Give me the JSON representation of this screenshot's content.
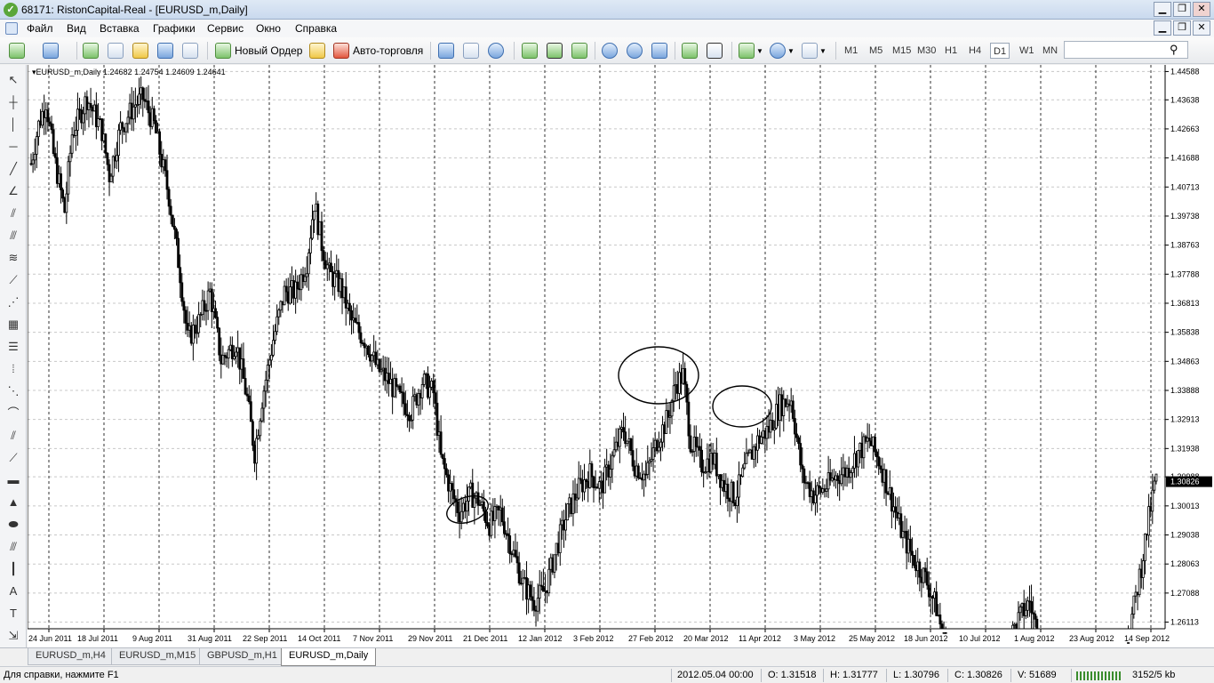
{
  "window": {
    "title": "68171: RistonCapital-Real - [EURUSD_m,Daily]",
    "icon": "terminal-logo-icon",
    "minimize": "▁",
    "restore": "❐",
    "close": "✕"
  },
  "menu": {
    "items": [
      "Файл",
      "Вид",
      "Вставка",
      "Графики",
      "Сервис",
      "Окно",
      "Справка"
    ]
  },
  "toolbar": {
    "new_order": "Новый Ордер",
    "auto_trading": "Авто-торговля",
    "timeframes": [
      "M1",
      "M5",
      "M15",
      "M30",
      "H1",
      "H4",
      "D1",
      "W1",
      "MN"
    ],
    "active_timeframe": "D1",
    "search_value": "",
    "search_icon": "magnifier-icon"
  },
  "chart": {
    "label": "EURUSD_m,Daily  1.24682 1.24754 1.24609 1.24641",
    "grid": "dashed",
    "background": "#ffffff",
    "candle_color": "#000000"
  },
  "chart_data": {
    "type": "candlestick",
    "symbol": "EURUSD_m",
    "timeframe": "Daily",
    "ohlc_last": {
      "open": 1.24682,
      "high": 1.24754,
      "low": 1.24609,
      "close": 1.24641
    },
    "price_ticks": [
      1.44588,
      1.43638,
      1.42663,
      1.41688,
      1.40713,
      1.39738,
      1.38763,
      1.37788,
      1.36813,
      1.35838,
      1.34863,
      1.33888,
      1.32913,
      1.31938,
      1.30988,
      1.30013,
      1.29038,
      1.28063,
      1.27088,
      1.26113
    ],
    "current_price": 1.30826,
    "ylim": [
      1.2595,
      1.4475
    ],
    "date_ticks": [
      "24 Jun 2011",
      "18 Jul 2011",
      "9 Aug 2011",
      "31 Aug 2011",
      "22 Sep 2011",
      "14 Oct 2011",
      "7 Nov 2011",
      "29 Nov 2011",
      "21 Dec 2011",
      "12 Jan 2012",
      "3 Feb 2012",
      "27 Feb 2012",
      "20 Mar 2012",
      "11 Apr 2012",
      "3 May 2012",
      "25 May 2012",
      "18 Jun 2012",
      "10 Jul 2012",
      "1 Aug 2012",
      "23 Aug 2012",
      "14 Sep 2012"
    ],
    "path_closes": [
      [
        0,
        1.415
      ],
      [
        4,
        1.428
      ],
      [
        8,
        1.436
      ],
      [
        12,
        1.418
      ],
      [
        18,
        1.399
      ],
      [
        22,
        1.425
      ],
      [
        30,
        1.437
      ],
      [
        38,
        1.426
      ],
      [
        42,
        1.411
      ],
      [
        48,
        1.427
      ],
      [
        56,
        1.435
      ],
      [
        60,
        1.437
      ],
      [
        66,
        1.428
      ],
      [
        74,
        1.404
      ],
      [
        80,
        1.378
      ],
      [
        84,
        1.356
      ],
      [
        90,
        1.362
      ],
      [
        96,
        1.372
      ],
      [
        102,
        1.349
      ],
      [
        110,
        1.355
      ],
      [
        116,
        1.336
      ],
      [
        120,
        1.318
      ],
      [
        124,
        1.336
      ],
      [
        130,
        1.356
      ],
      [
        136,
        1.372
      ],
      [
        142,
        1.372
      ],
      [
        148,
        1.382
      ],
      [
        152,
        1.402
      ],
      [
        156,
        1.388
      ],
      [
        160,
        1.378
      ],
      [
        166,
        1.374
      ],
      [
        172,
        1.362
      ],
      [
        180,
        1.355
      ],
      [
        186,
        1.346
      ],
      [
        192,
        1.342
      ],
      [
        198,
        1.336
      ],
      [
        204,
        1.332
      ],
      [
        210,
        1.342
      ],
      [
        216,
        1.338
      ],
      [
        220,
        1.316
      ],
      [
        226,
        1.304
      ],
      [
        230,
        1.298
      ],
      [
        236,
        1.304
      ],
      [
        240,
        1.302
      ],
      [
        246,
        1.294
      ],
      [
        252,
        1.298
      ],
      [
        258,
        1.286
      ],
      [
        264,
        1.274
      ],
      [
        270,
        1.268
      ],
      [
        276,
        1.272
      ],
      [
        282,
        1.286
      ],
      [
        288,
        1.298
      ],
      [
        294,
        1.306
      ],
      [
        300,
        1.311
      ],
      [
        306,
        1.306
      ],
      [
        312,
        1.316
      ],
      [
        318,
        1.326
      ],
      [
        324,
        1.314
      ],
      [
        330,
        1.31
      ],
      [
        336,
        1.322
      ],
      [
        342,
        1.33
      ],
      [
        346,
        1.341
      ],
      [
        350,
        1.344
      ],
      [
        354,
        1.322
      ],
      [
        360,
        1.314
      ],
      [
        366,
        1.316
      ],
      [
        372,
        1.307
      ],
      [
        378,
        1.303
      ],
      [
        384,
        1.314
      ],
      [
        390,
        1.322
      ],
      [
        396,
        1.326
      ],
      [
        402,
        1.334
      ],
      [
        408,
        1.336
      ],
      [
        414,
        1.31
      ],
      [
        420,
        1.304
      ],
      [
        426,
        1.306
      ],
      [
        432,
        1.31
      ],
      [
        438,
        1.312
      ],
      [
        444,
        1.318
      ],
      [
        450,
        1.322
      ],
      [
        456,
        1.314
      ],
      [
        462,
        1.302
      ],
      [
        468,
        1.29
      ],
      [
        474,
        1.282
      ],
      [
        480,
        1.276
      ],
      [
        486,
        1.266
      ],
      [
        490,
        1.255
      ],
      [
        500,
        1.24
      ],
      [
        510,
        1.236
      ],
      [
        520,
        1.248
      ],
      [
        530,
        1.262
      ],
      [
        536,
        1.268
      ],
      [
        540,
        1.258
      ],
      [
        548,
        1.232
      ],
      [
        556,
        1.228
      ],
      [
        564,
        1.236
      ],
      [
        570,
        1.24
      ],
      [
        576,
        1.238
      ],
      [
        582,
        1.24
      ],
      [
        588,
        1.254
      ],
      [
        592,
        1.266
      ],
      [
        596,
        1.28
      ],
      [
        600,
        1.296
      ],
      [
        604,
        1.31
      ]
    ]
  },
  "annotations": [
    "ellipse-1",
    "ellipse-2",
    "ellipse-3"
  ],
  "tabs": [
    "EURUSD_m,H4",
    "EURUSD_m,M15",
    "GBPUSD_m,H1",
    "EURUSD_m,Daily"
  ],
  "active_tab": "EURUSD_m,Daily",
  "status": {
    "help": "Для справки, нажмите F1",
    "datetime": "2012.05.04 00:00",
    "open": "O: 1.31518",
    "high": "H: 1.31777",
    "low": "L: 1.30796",
    "close": "C: 1.30826",
    "volume": "V: 51689",
    "traffic": "3152/5 kb"
  }
}
